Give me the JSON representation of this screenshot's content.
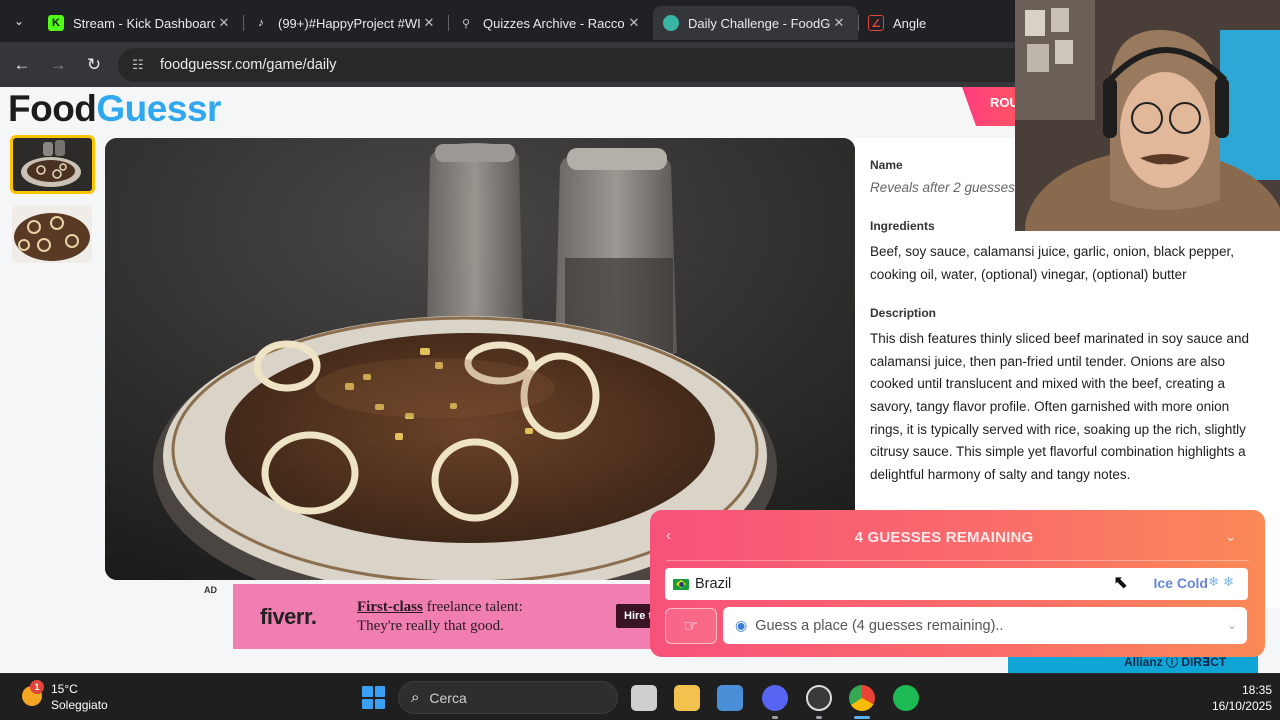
{
  "browser": {
    "tabs": [
      {
        "title": "Stream - Kick Dashboard",
        "icon": "kick-icon",
        "color": "#53fc18",
        "glyph": "K"
      },
      {
        "title": "(99+)#HappyProject #WI",
        "icon": "tiktok-icon",
        "color": "#ffffff",
        "glyph": "♪"
      },
      {
        "title": "Quizzes Archive - Raccolt",
        "icon": "archive-icon",
        "color": "#9aa0a6",
        "glyph": "⚲"
      },
      {
        "title": "Daily Challenge - FoodGu",
        "icon": "foodguessr-icon",
        "color": "#3ab6a6",
        "glyph": "●"
      },
      {
        "title": "Angle",
        "icon": "angle-icon",
        "color": "#e2453c",
        "glyph": "∠"
      }
    ],
    "close_glyph": "✕",
    "url": "foodguessr.com/game/daily"
  },
  "page": {
    "logo": {
      "part1": "Food",
      "part2": "Guessr"
    },
    "round_label": "ROU",
    "info": {
      "name_heading": "Name",
      "name_value": "Reveals after 2 guesses",
      "ingredients_heading": "Ingredients",
      "ingredients": "Beef, soy sauce, calamansi juice, garlic, onion, black pepper, cooking oil, water, (optional) vinegar, (optional) butter",
      "description_heading": "Description",
      "description": "This dish features thinly sliced beef marinated in soy sauce and calamansi juice, then pan-fried until tender. Onions are also cooked until translucent and mixed with the beef, creating a savory, tangy flavor profile. Often garnished with more onion rings, it is typically served with rice, soaking up the rich, slightly citrusy sauce. This simple yet flavorful combination highlights a delightful harmony of salty and tangy notes."
    },
    "ad": {
      "label": "AD",
      "brand": "fiverr.",
      "line1_bold": "First-class",
      "line1_rest": " freelance talent:",
      "line2": "They're really that good.",
      "cta": "Hire t"
    },
    "allianz": "Allianz ⓘ DIR∃CT"
  },
  "guess_panel": {
    "title": "4 GUESSES REMAINING",
    "guesses": [
      {
        "country": "Brazil",
        "temperature": "Ice Cold",
        "snow": "❄❄"
      }
    ],
    "input_placeholder": "Guess a place (4 guesses remaining)..",
    "accent_color": "#f7517a"
  },
  "taskbar": {
    "weather": {
      "badge": "1",
      "temperature": "15°C",
      "condition": "Soleggiato"
    },
    "search_placeholder": "Cerca",
    "time": "18:35",
    "date": "16/10/2025"
  }
}
